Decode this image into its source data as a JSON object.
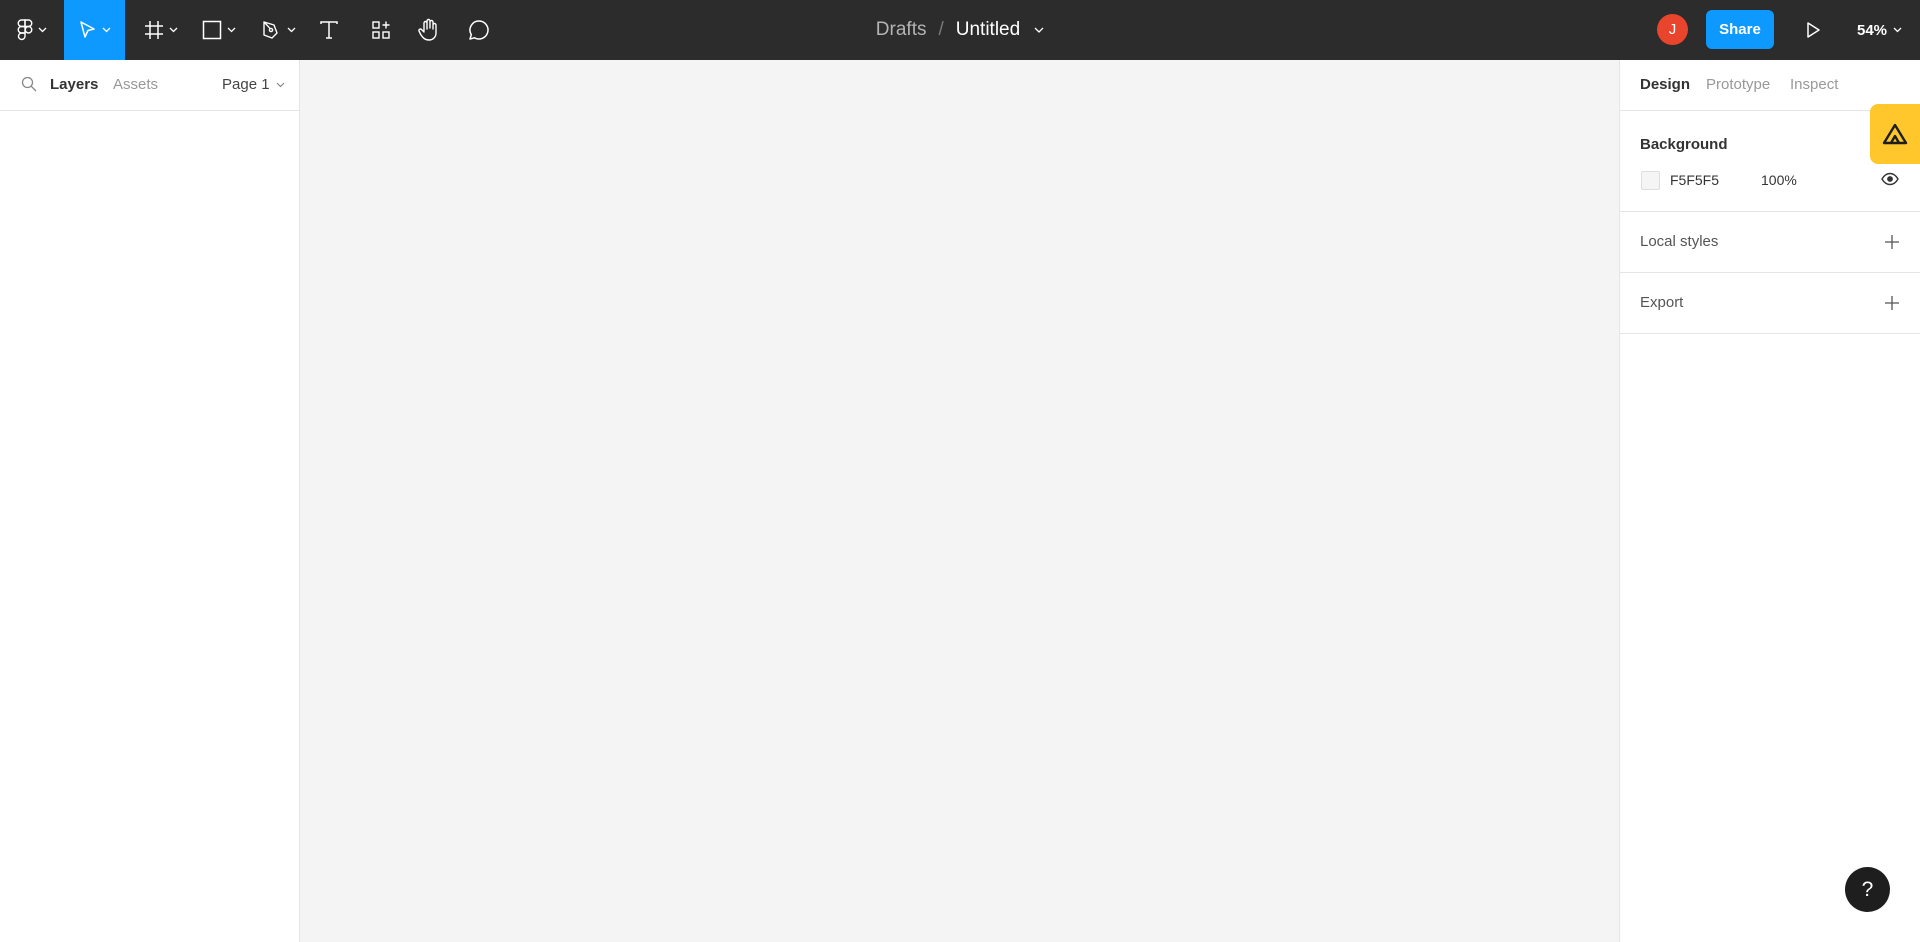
{
  "toolbar": {
    "main_menu_icon": "figma-logo-icon",
    "tools": [
      {
        "name": "move",
        "icon": "pointer-icon",
        "active": true
      },
      {
        "name": "frame",
        "icon": "frame-hash-icon"
      },
      {
        "name": "shape",
        "icon": "rectangle-icon"
      },
      {
        "name": "pen",
        "icon": "pen-icon"
      },
      {
        "name": "text",
        "icon": "text-icon"
      },
      {
        "name": "resources",
        "icon": "components-icon"
      },
      {
        "name": "hand",
        "icon": "hand-icon"
      },
      {
        "name": "comment",
        "icon": "comment-bubble-icon"
      }
    ],
    "breadcrumb": "Drafts",
    "separator": "/",
    "file_title": "Untitled",
    "avatar_initial": "J",
    "share_label": "Share",
    "zoom": "54%"
  },
  "left_panel": {
    "tabs": [
      "Layers",
      "Assets"
    ],
    "active_tab": "Layers",
    "page_selector": "Page 1"
  },
  "right_panel": {
    "tabs": [
      "Design",
      "Prototype",
      "Inspect"
    ],
    "active_tab": "Design",
    "background": {
      "title": "Background",
      "hex": "F5F5F5",
      "opacity": "100%",
      "swatch_color": "#F5F5F5"
    },
    "local_styles_label": "Local styles",
    "export_label": "Export"
  },
  "help_label": "?",
  "colors": {
    "toolbar_bg": "#2c2c2c",
    "accent": "#0d99ff",
    "avatar": "#e8452c",
    "plugin_badge": "#ffc72b",
    "canvas": "#f4f4f4"
  }
}
